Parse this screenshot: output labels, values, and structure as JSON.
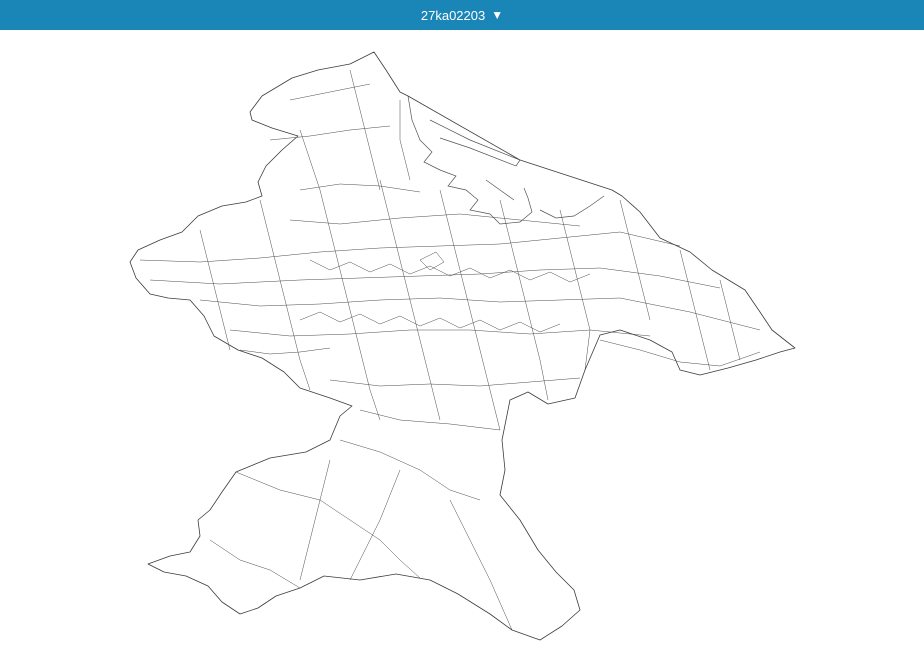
{
  "header": {
    "selector_label": "27ka02203",
    "caret_icon": "triangle-down",
    "background_color": "#1a86b8",
    "text_color": "#ffffff"
  },
  "map": {
    "boundary_color": "#3b3b3b",
    "background_color": "#ffffff"
  }
}
